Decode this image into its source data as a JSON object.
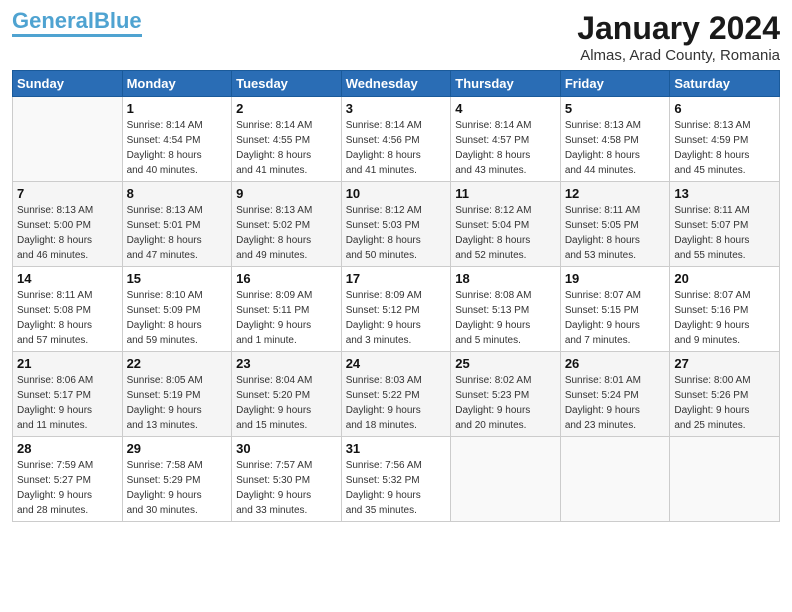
{
  "header": {
    "logo_general": "General",
    "logo_blue": "Blue",
    "title": "January 2024",
    "location": "Almas, Arad County, Romania"
  },
  "days_of_week": [
    "Sunday",
    "Monday",
    "Tuesday",
    "Wednesday",
    "Thursday",
    "Friday",
    "Saturday"
  ],
  "weeks": [
    [
      {
        "day": "",
        "info": ""
      },
      {
        "day": "1",
        "info": "Sunrise: 8:14 AM\nSunset: 4:54 PM\nDaylight: 8 hours\nand 40 minutes."
      },
      {
        "day": "2",
        "info": "Sunrise: 8:14 AM\nSunset: 4:55 PM\nDaylight: 8 hours\nand 41 minutes."
      },
      {
        "day": "3",
        "info": "Sunrise: 8:14 AM\nSunset: 4:56 PM\nDaylight: 8 hours\nand 41 minutes."
      },
      {
        "day": "4",
        "info": "Sunrise: 8:14 AM\nSunset: 4:57 PM\nDaylight: 8 hours\nand 43 minutes."
      },
      {
        "day": "5",
        "info": "Sunrise: 8:13 AM\nSunset: 4:58 PM\nDaylight: 8 hours\nand 44 minutes."
      },
      {
        "day": "6",
        "info": "Sunrise: 8:13 AM\nSunset: 4:59 PM\nDaylight: 8 hours\nand 45 minutes."
      }
    ],
    [
      {
        "day": "7",
        "info": "Sunrise: 8:13 AM\nSunset: 5:00 PM\nDaylight: 8 hours\nand 46 minutes."
      },
      {
        "day": "8",
        "info": "Sunrise: 8:13 AM\nSunset: 5:01 PM\nDaylight: 8 hours\nand 47 minutes."
      },
      {
        "day": "9",
        "info": "Sunrise: 8:13 AM\nSunset: 5:02 PM\nDaylight: 8 hours\nand 49 minutes."
      },
      {
        "day": "10",
        "info": "Sunrise: 8:12 AM\nSunset: 5:03 PM\nDaylight: 8 hours\nand 50 minutes."
      },
      {
        "day": "11",
        "info": "Sunrise: 8:12 AM\nSunset: 5:04 PM\nDaylight: 8 hours\nand 52 minutes."
      },
      {
        "day": "12",
        "info": "Sunrise: 8:11 AM\nSunset: 5:05 PM\nDaylight: 8 hours\nand 53 minutes."
      },
      {
        "day": "13",
        "info": "Sunrise: 8:11 AM\nSunset: 5:07 PM\nDaylight: 8 hours\nand 55 minutes."
      }
    ],
    [
      {
        "day": "14",
        "info": "Sunrise: 8:11 AM\nSunset: 5:08 PM\nDaylight: 8 hours\nand 57 minutes."
      },
      {
        "day": "15",
        "info": "Sunrise: 8:10 AM\nSunset: 5:09 PM\nDaylight: 8 hours\nand 59 minutes."
      },
      {
        "day": "16",
        "info": "Sunrise: 8:09 AM\nSunset: 5:11 PM\nDaylight: 9 hours\nand 1 minute."
      },
      {
        "day": "17",
        "info": "Sunrise: 8:09 AM\nSunset: 5:12 PM\nDaylight: 9 hours\nand 3 minutes."
      },
      {
        "day": "18",
        "info": "Sunrise: 8:08 AM\nSunset: 5:13 PM\nDaylight: 9 hours\nand 5 minutes."
      },
      {
        "day": "19",
        "info": "Sunrise: 8:07 AM\nSunset: 5:15 PM\nDaylight: 9 hours\nand 7 minutes."
      },
      {
        "day": "20",
        "info": "Sunrise: 8:07 AM\nSunset: 5:16 PM\nDaylight: 9 hours\nand 9 minutes."
      }
    ],
    [
      {
        "day": "21",
        "info": "Sunrise: 8:06 AM\nSunset: 5:17 PM\nDaylight: 9 hours\nand 11 minutes."
      },
      {
        "day": "22",
        "info": "Sunrise: 8:05 AM\nSunset: 5:19 PM\nDaylight: 9 hours\nand 13 minutes."
      },
      {
        "day": "23",
        "info": "Sunrise: 8:04 AM\nSunset: 5:20 PM\nDaylight: 9 hours\nand 15 minutes."
      },
      {
        "day": "24",
        "info": "Sunrise: 8:03 AM\nSunset: 5:22 PM\nDaylight: 9 hours\nand 18 minutes."
      },
      {
        "day": "25",
        "info": "Sunrise: 8:02 AM\nSunset: 5:23 PM\nDaylight: 9 hours\nand 20 minutes."
      },
      {
        "day": "26",
        "info": "Sunrise: 8:01 AM\nSunset: 5:24 PM\nDaylight: 9 hours\nand 23 minutes."
      },
      {
        "day": "27",
        "info": "Sunrise: 8:00 AM\nSunset: 5:26 PM\nDaylight: 9 hours\nand 25 minutes."
      }
    ],
    [
      {
        "day": "28",
        "info": "Sunrise: 7:59 AM\nSunset: 5:27 PM\nDaylight: 9 hours\nand 28 minutes."
      },
      {
        "day": "29",
        "info": "Sunrise: 7:58 AM\nSunset: 5:29 PM\nDaylight: 9 hours\nand 30 minutes."
      },
      {
        "day": "30",
        "info": "Sunrise: 7:57 AM\nSunset: 5:30 PM\nDaylight: 9 hours\nand 33 minutes."
      },
      {
        "day": "31",
        "info": "Sunrise: 7:56 AM\nSunset: 5:32 PM\nDaylight: 9 hours\nand 35 minutes."
      },
      {
        "day": "",
        "info": ""
      },
      {
        "day": "",
        "info": ""
      },
      {
        "day": "",
        "info": ""
      }
    ]
  ]
}
